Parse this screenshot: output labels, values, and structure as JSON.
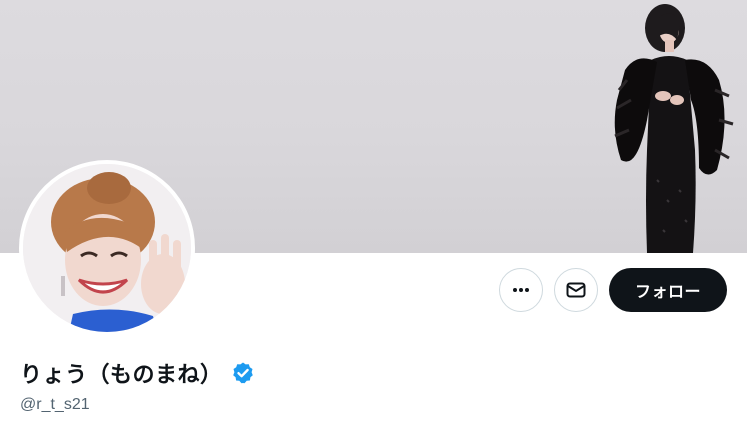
{
  "profile": {
    "display_name": "りょう（ものまね）",
    "handle": "@r_t_s21",
    "verified": true
  },
  "actions": {
    "more_icon": "more-horizontal-icon",
    "message_icon": "mail-icon",
    "follow_label": "フォロー"
  },
  "colors": {
    "follow_button_bg": "#0f1419",
    "verified_badge": "#1d9bf0",
    "handle_text": "#536471",
    "banner_bg": "#d9d7db"
  }
}
